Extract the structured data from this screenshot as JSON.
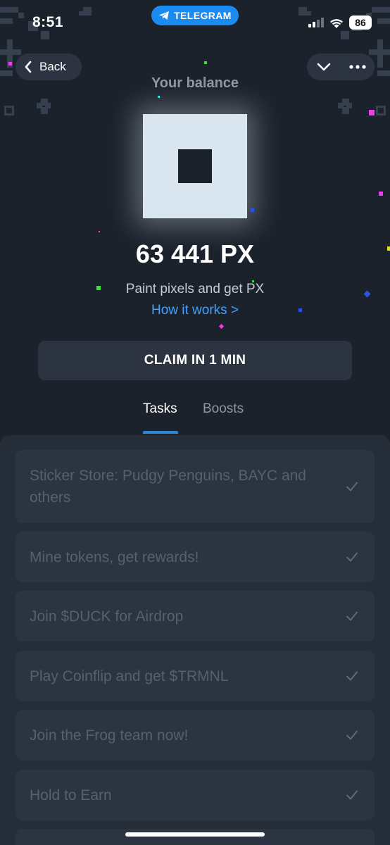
{
  "status_bar": {
    "time": "8:51",
    "telegram_label": "TELEGRAM",
    "battery": "86"
  },
  "nav": {
    "back_label": "Back"
  },
  "header": {
    "balance_label": "Your balance"
  },
  "balance": {
    "value": "63 441 PX"
  },
  "info": {
    "subtitle": "Paint pixels and get PX",
    "how_link": "How it works >"
  },
  "claim": {
    "label": "CLAIM IN 1 MIN"
  },
  "tabs": [
    {
      "label": "Tasks",
      "active": true
    },
    {
      "label": "Boosts",
      "active": false
    }
  ],
  "tasks": [
    {
      "label": "Sticker Store: Pudgy Penguins, BAYC and others",
      "done": true
    },
    {
      "label": "Mine tokens, get rewards!",
      "done": true
    },
    {
      "label": "Join $DUCK for Airdrop",
      "done": true
    },
    {
      "label": "Play Coinflip and get $TRMNL",
      "done": true
    },
    {
      "label": "Join the Frog team now!",
      "done": true
    },
    {
      "label": "Hold to Earn",
      "done": true
    }
  ],
  "colors": {
    "background": "#1c222c",
    "panel": "#252d39",
    "card": "#2c3441",
    "accent": "#3fa3ff",
    "telegram": "#1a8bf0"
  }
}
